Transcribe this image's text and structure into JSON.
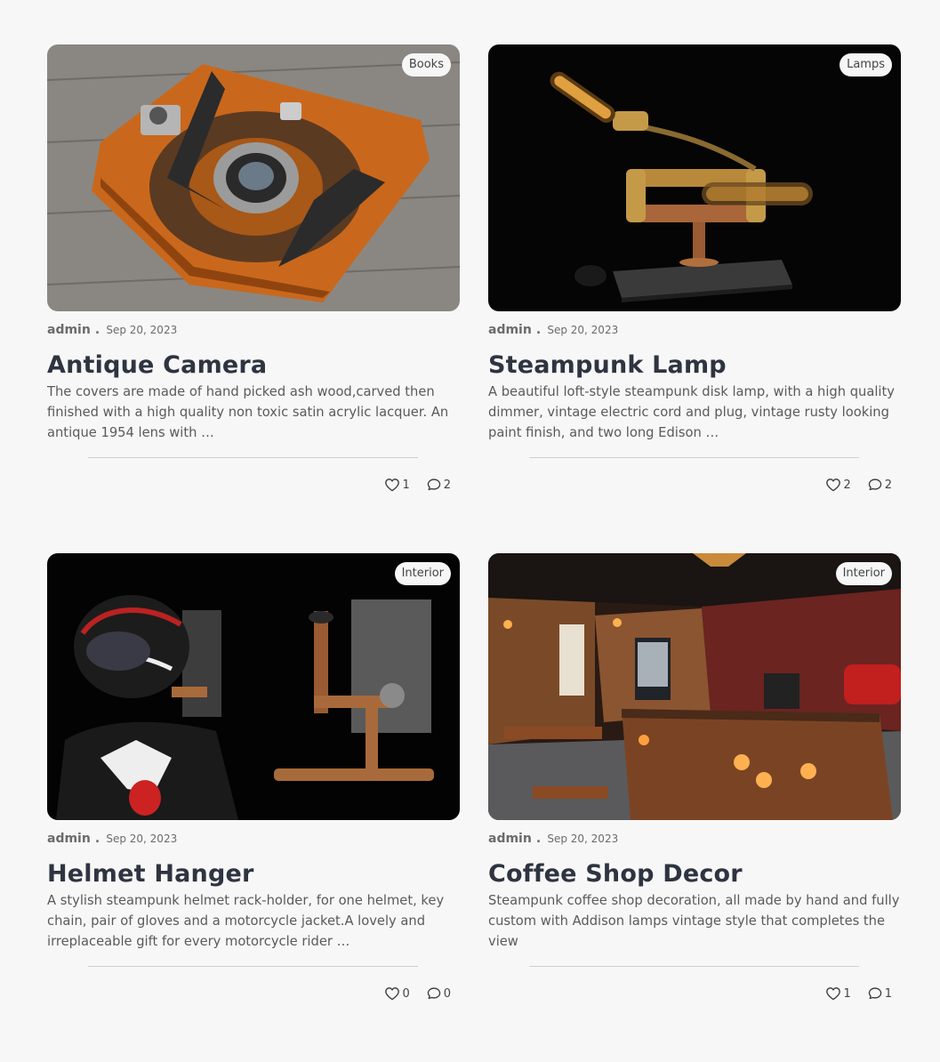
{
  "posts": [
    {
      "category": "Books",
      "author": "admin",
      "separator": ".",
      "date": "Sep 20, 2023",
      "title": "Antique Camera",
      "excerpt": "The covers are made of hand picked ash wood,carved then finished with a high quality non toxic  satin acrylic lacquer. An antique 1954 lens with …",
      "likes": "1",
      "comments": "2"
    },
    {
      "category": "Lamps",
      "author": "admin",
      "separator": ".",
      "date": "Sep 20, 2023",
      "title": "Steampunk Lamp",
      "excerpt": "A beautiful loft-style steampunk disk lamp, with a high quality dimmer, vintage electric cord and plug, vintage rusty looking paint finish, and two long Edison …",
      "likes": "2",
      "comments": "2"
    },
    {
      "category": "Interior",
      "author": "admin",
      "separator": ".",
      "date": "Sep 20, 2023",
      "title": "Helmet Hanger",
      "excerpt": "A stylish steampunk helmet rack-holder, for one helmet, key chain, pair of gloves and a motorcycle jacket.A lovely and irreplaceable gift for every motorcycle rider …",
      "likes": "0",
      "comments": "0"
    },
    {
      "category": "Interior",
      "author": "admin",
      "separator": ".",
      "date": "Sep 20, 2023",
      "title": "Coffee Shop Decor",
      "excerpt": "Steampunk coffee shop decoration, all made by hand and fully custom with Addison lamps vintage style that completes the view",
      "likes": "1",
      "comments": "1"
    }
  ],
  "icons": {
    "like": "heart-icon",
    "comment": "comment-icon"
  }
}
